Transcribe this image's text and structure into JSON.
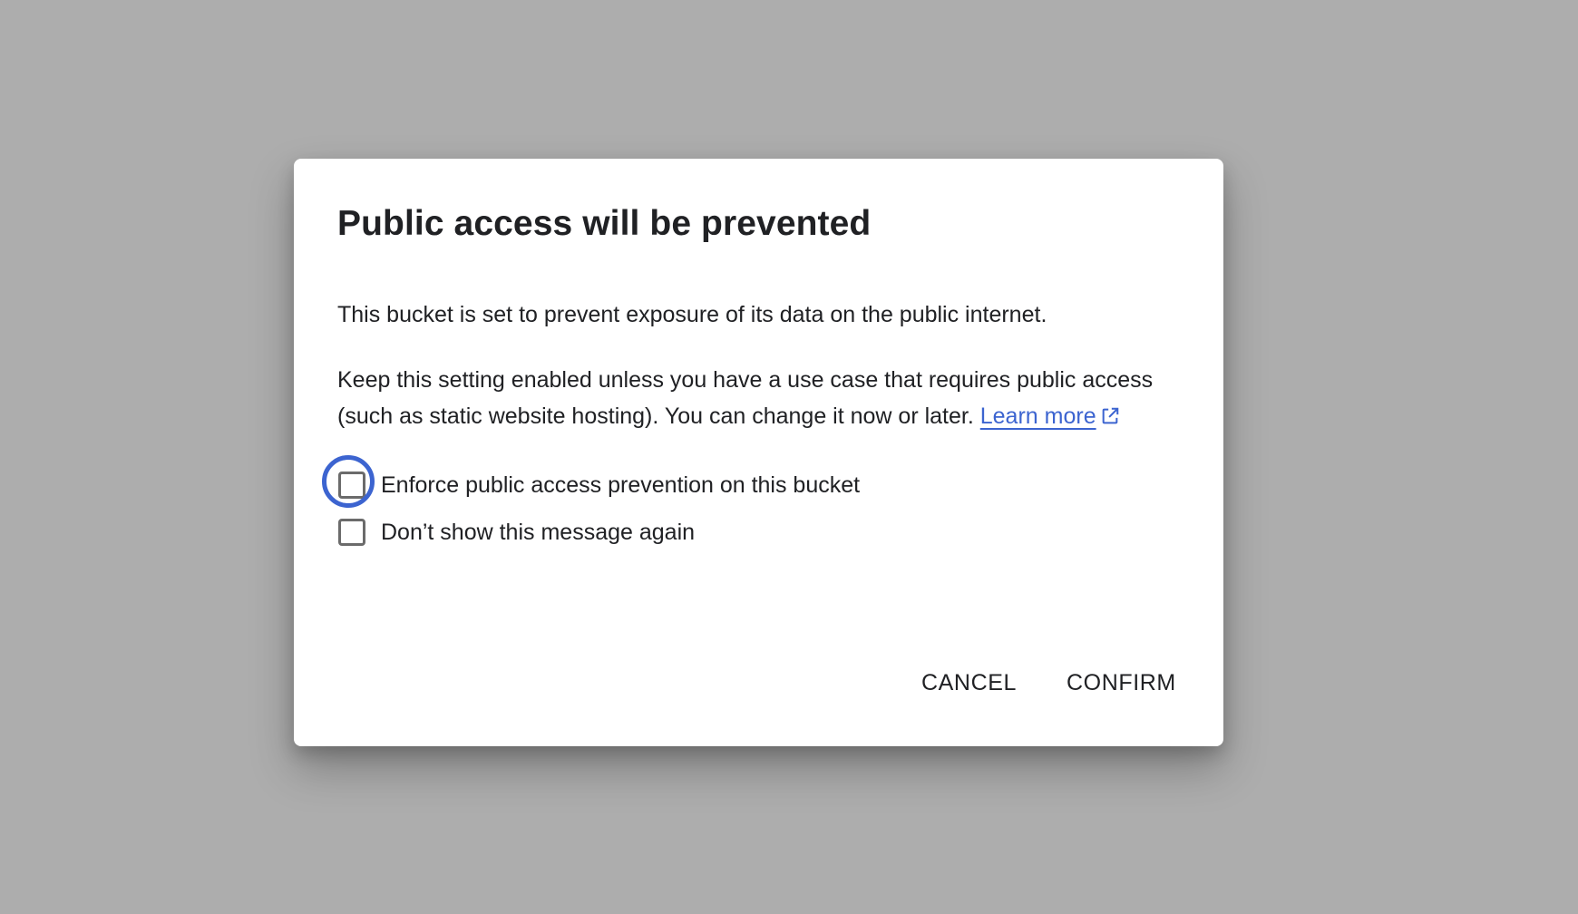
{
  "dialog": {
    "title": "Public access will be prevented",
    "paragraph1": "This bucket is set to prevent exposure of its data on the public internet.",
    "paragraph2": "Keep this setting enabled unless you have a use case that requires public access (such as static website hosting). You can change it now or later.",
    "learn_more": "Learn more",
    "link_icon": "open-in-new-icon",
    "accent_color": "#3c64d0"
  },
  "checkboxes": [
    {
      "label": "Enforce public access prevention on this bucket",
      "checked": false,
      "focused": true
    },
    {
      "label": "Don’t show this message again",
      "checked": false,
      "focused": false
    }
  ],
  "actions": {
    "cancel_label": "CANCEL",
    "confirm_label": "CONFIRM"
  }
}
